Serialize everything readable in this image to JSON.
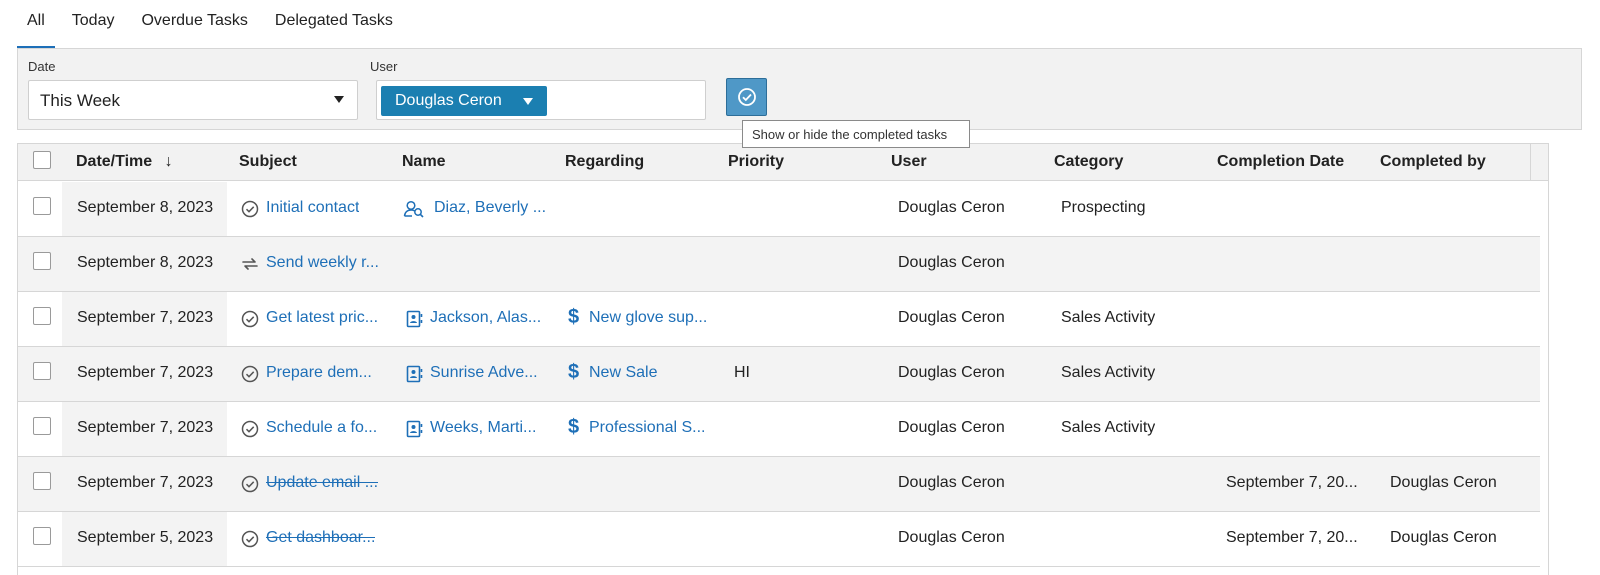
{
  "tabs": [
    {
      "label": "All",
      "active": true
    },
    {
      "label": "Today"
    },
    {
      "label": "Overdue Tasks"
    },
    {
      "label": "Delegated Tasks"
    }
  ],
  "filters": {
    "date_label": "Date",
    "date_value": "This Week",
    "user_label": "User",
    "user_value": "Douglas Ceron",
    "toggle_icon": "check-circle-icon",
    "tooltip": "Show or hide the completed tasks"
  },
  "columns": [
    "Date/Time",
    "Subject",
    "Name",
    "Regarding",
    "Priority",
    "User",
    "Category",
    "Completion Date",
    "Completed by"
  ],
  "sort_indicator": "↓",
  "colors": {
    "accent": "#1b7fb1",
    "link": "#1e6fb7"
  },
  "rows": [
    {
      "date": "September 8, 2023",
      "subject_icon": "check-circle-icon",
      "subject": "Initial contact",
      "completed": false,
      "name_icon": "contact-icon",
      "name": "Diaz, Beverly ...",
      "regarding": "",
      "priority": "",
      "user": "Douglas Ceron",
      "category": "Prospecting",
      "completion_date": "",
      "completed_by": ""
    },
    {
      "date": "September 8, 2023",
      "subject_icon": "recurring-icon",
      "subject": "Send weekly r...",
      "completed": false,
      "name_icon": "",
      "name": "",
      "regarding": "",
      "priority": "",
      "user": "Douglas Ceron",
      "category": "",
      "completion_date": "",
      "completed_by": ""
    },
    {
      "date": "September 7, 2023",
      "subject_icon": "check-circle-icon",
      "subject": "Get latest pric...",
      "completed": false,
      "name_icon": "company-icon",
      "name": "Jackson, Alas...",
      "regarding_icon": "dollar-icon",
      "regarding": "New glove sup...",
      "priority": "",
      "user": "Douglas Ceron",
      "category": "Sales Activity",
      "completion_date": "",
      "completed_by": ""
    },
    {
      "date": "September 7, 2023",
      "subject_icon": "check-circle-icon",
      "subject": "Prepare dem...",
      "completed": false,
      "name_icon": "company-icon",
      "name": "Sunrise Adve...",
      "regarding_icon": "dollar-icon",
      "regarding": "New Sale",
      "priority": "HI",
      "user": "Douglas Ceron",
      "category": "Sales Activity",
      "completion_date": "",
      "completed_by": ""
    },
    {
      "date": "September 7, 2023",
      "subject_icon": "check-circle-icon",
      "subject": "Schedule a fo...",
      "completed": false,
      "name_icon": "company-icon",
      "name": "Weeks, Marti...",
      "regarding_icon": "dollar-icon",
      "regarding": "Professional S...",
      "priority": "",
      "user": "Douglas Ceron",
      "category": "Sales Activity",
      "completion_date": "",
      "completed_by": ""
    },
    {
      "date": "September 7, 2023",
      "subject_icon": "check-circle-icon",
      "subject": "Update email ...",
      "completed": true,
      "name_icon": "",
      "name": "",
      "regarding": "",
      "priority": "",
      "user": "Douglas Ceron",
      "category": "",
      "completion_date": "September 7, 20...",
      "completed_by": "Douglas Ceron"
    },
    {
      "date": "September 5, 2023",
      "subject_icon": "check-circle-icon",
      "subject": "Get dashboar...",
      "completed": true,
      "name_icon": "",
      "name": "",
      "regarding": "",
      "priority": "",
      "user": "Douglas Ceron",
      "category": "",
      "completion_date": "September 7, 20...",
      "completed_by": "Douglas Ceron"
    }
  ]
}
